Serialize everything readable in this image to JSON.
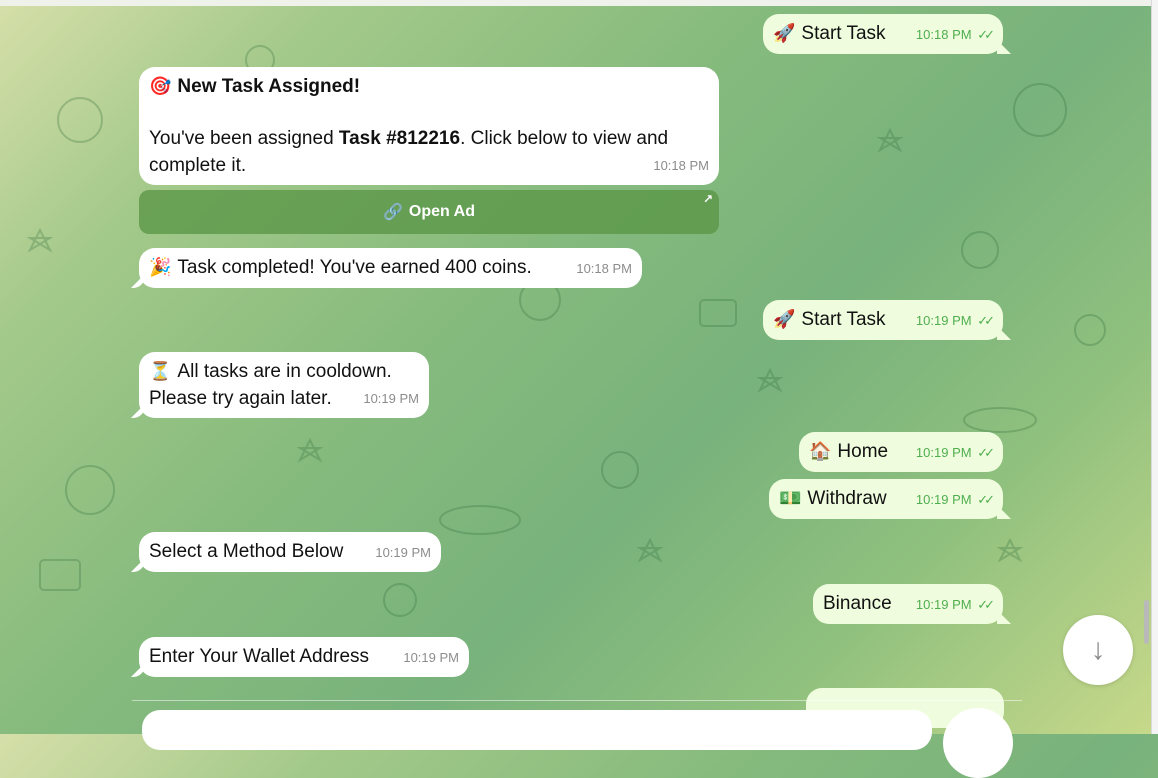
{
  "messages": {
    "start_task_1": {
      "emoji": "🚀",
      "text": "Start Task",
      "time": "10:18 PM"
    },
    "new_task": {
      "emoji": "🎯",
      "title": "New Task Assigned!",
      "body_prefix": "You've been assigned ",
      "task_id": "Task #812216",
      "body_suffix": ". Click below to view and complete it.",
      "time": "10:18 PM"
    },
    "open_ad_button": {
      "icon": "🔗",
      "label": "Open Ad",
      "corner": "↗"
    },
    "task_completed": {
      "emoji": "🎉",
      "text": "Task completed! You've earned 400 coins.",
      "time": "10:18 PM"
    },
    "start_task_2": {
      "emoji": "🚀",
      "text": "Start Task",
      "time": "10:19 PM"
    },
    "cooldown": {
      "emoji": "⏳",
      "line1": "All tasks are in cooldown.",
      "line2": "Please try again later.",
      "time": "10:19 PM"
    },
    "home": {
      "emoji": "🏠",
      "text": "Home",
      "time": "10:19 PM"
    },
    "withdraw": {
      "emoji": "💵",
      "text": "Withdraw",
      "time": "10:19 PM"
    },
    "select_method": {
      "text": "Select a Method Below",
      "time": "10:19 PM"
    },
    "binance": {
      "text": "Binance",
      "time": "10:19 PM"
    },
    "wallet_address": {
      "text": "Enter Your Wallet Address",
      "time": "10:19 PM"
    }
  },
  "ticks": "✓✓",
  "scroll_down_icon": "↓",
  "colors": {
    "incoming": "#ffffff",
    "outgoing": "#effdde",
    "time_out": "#4fae4e",
    "button": "#5a9646"
  }
}
